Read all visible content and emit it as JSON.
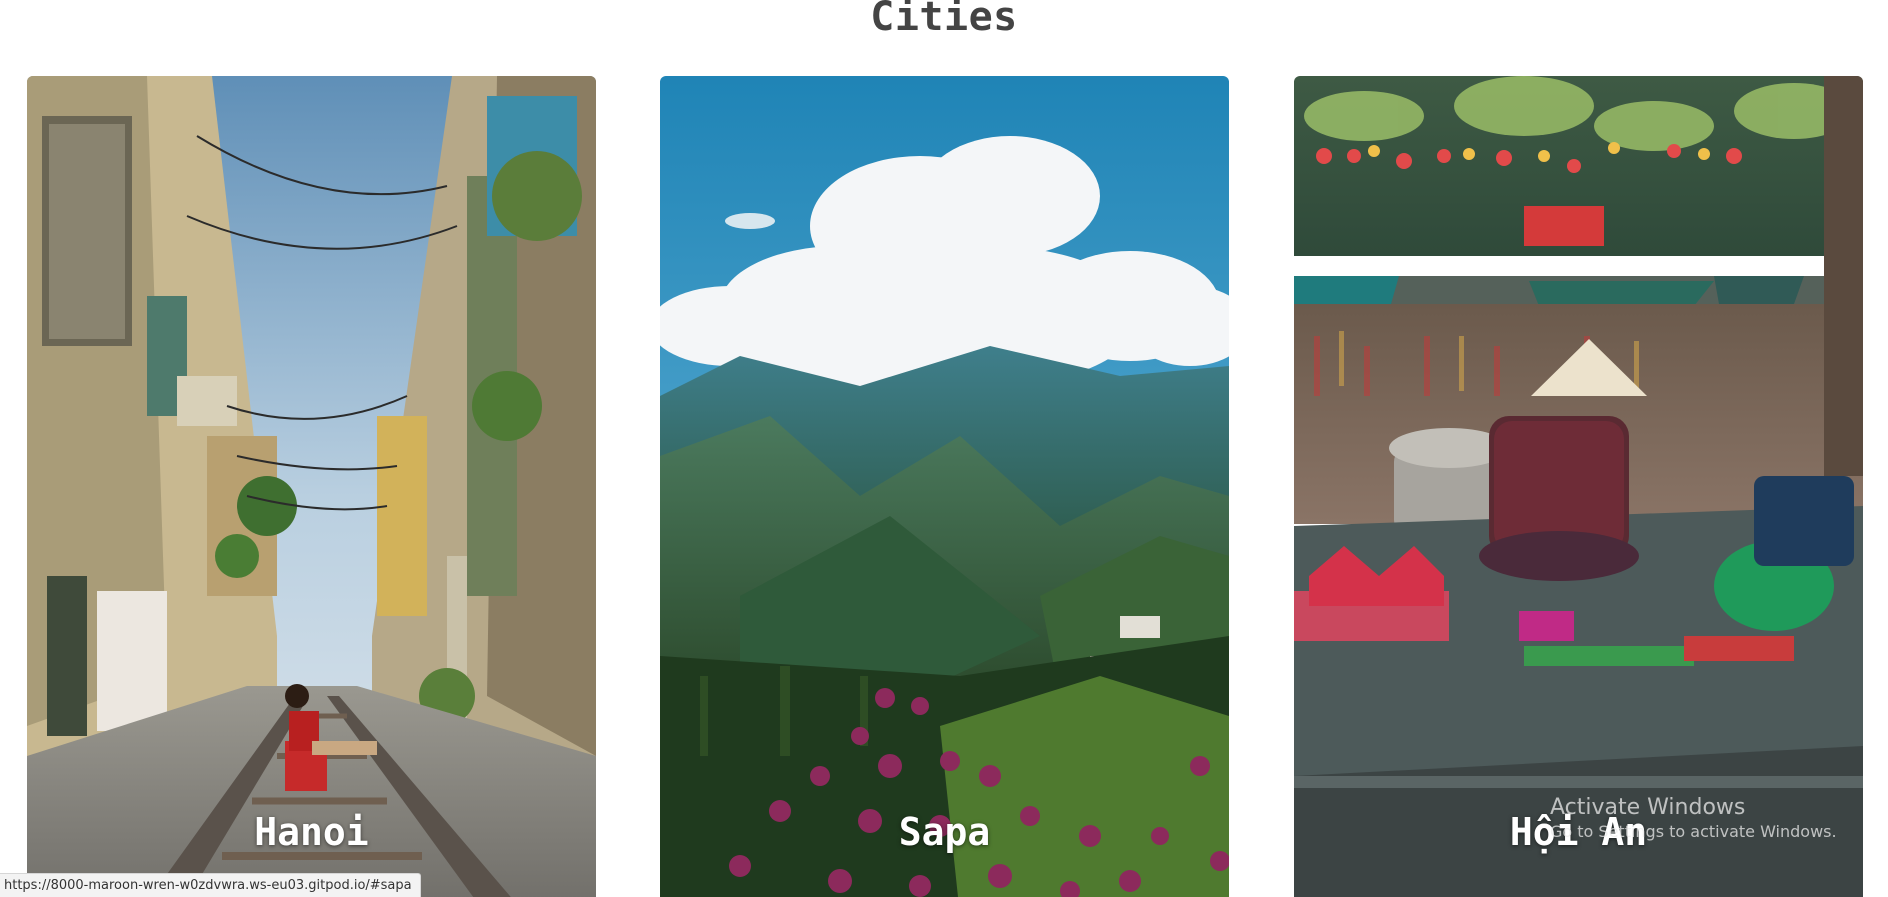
{
  "section": {
    "title": "Cities"
  },
  "cards": [
    {
      "label": "Hanoi",
      "image": "hanoi-train-street-photo"
    },
    {
      "label": "Sapa",
      "image": "sapa-mountains-photo"
    },
    {
      "label": "Hội An",
      "image": "hoi-an-street-vendor-photo"
    }
  ],
  "watermark": {
    "title": "Activate Windows",
    "subtitle": "Go to Settings to activate Windows."
  },
  "status_bar": {
    "url": "https://8000-maroon-wren-w0zdvwra.ws-eu03.gitpod.io/#sapa"
  },
  "colors": {
    "title": "#444444",
    "label": "#ffffff",
    "background": "#ffffff"
  }
}
